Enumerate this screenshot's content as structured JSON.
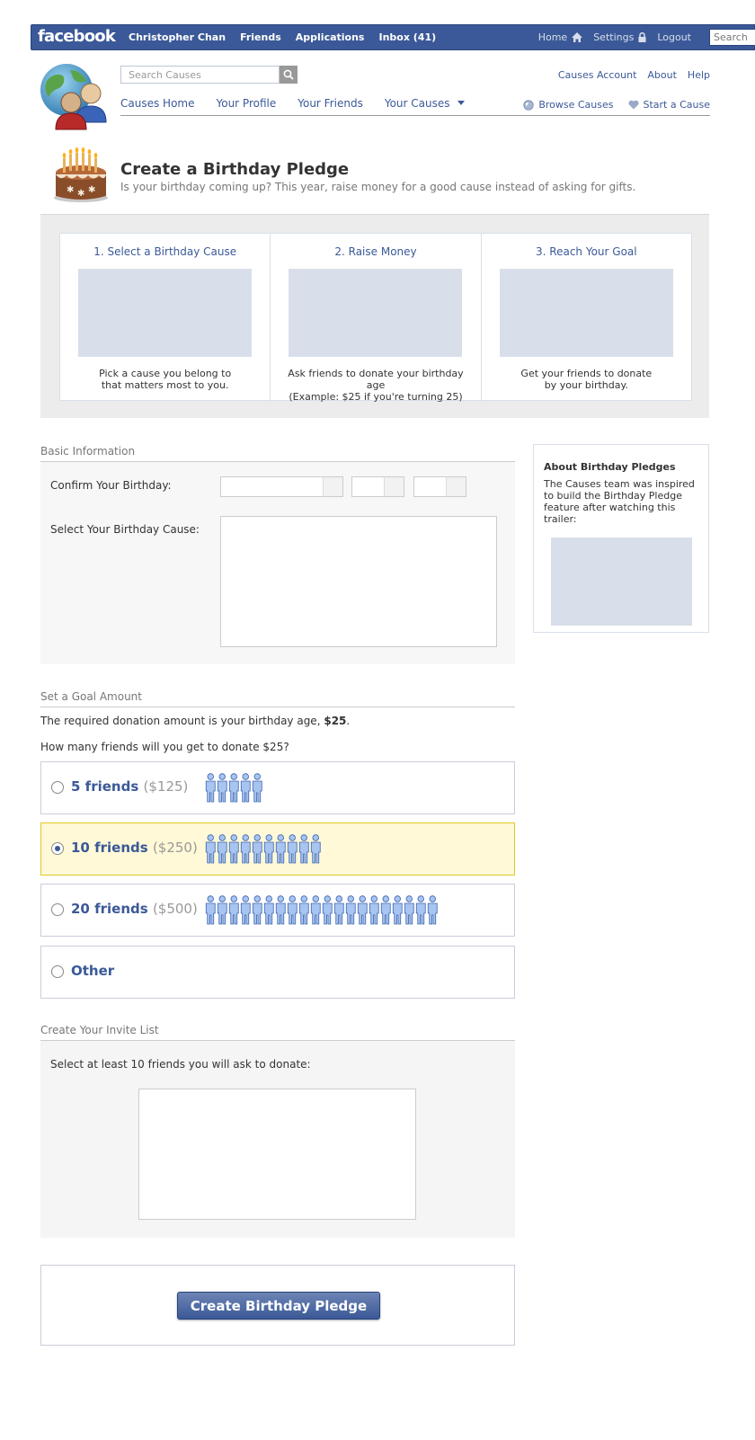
{
  "topbar": {
    "logo": "facebook",
    "nav": [
      "Christopher Chan",
      "Friends",
      "Applications",
      "Inbox (41)"
    ],
    "home": "Home",
    "settings": "Settings",
    "logout": "Logout",
    "search_placeholder": "Search"
  },
  "causes_header": {
    "search_placeholder": "Search Causes",
    "top_links": [
      "Causes Account",
      "About",
      "Help"
    ],
    "tabs": [
      "Causes Home",
      "Your Profile",
      "Your Friends",
      "Your Causes"
    ],
    "browse": "Browse Causes",
    "start": "Start a Cause"
  },
  "page": {
    "title": "Create a Birthday Pledge",
    "subtitle": "Is your birthday coming up? This year, raise money for a good cause instead of asking for gifts."
  },
  "steps": [
    {
      "title": "1. Select a Birthday Cause",
      "desc1": "Pick a cause you belong to",
      "desc2": "that matters most to you."
    },
    {
      "title": "2. Raise Money",
      "desc1": "Ask friends to donate your birthday age",
      "desc2": "(Example: $25 if you're turning 25)"
    },
    {
      "title": "3. Reach Your Goal",
      "desc1": "Get your friends to donate",
      "desc2": "by your birthday."
    }
  ],
  "basic": {
    "header": "Basic Information",
    "birthday_label": "Confirm Your Birthday:",
    "cause_label": "Select Your Birthday Cause:"
  },
  "about": {
    "title": "About Birthday Pledges",
    "desc": "The Causes team was inspired to build the Birthday Pledge feature after watching this trailer:"
  },
  "goal": {
    "header": "Set a Goal Amount",
    "required_prefix": "The required donation amount is your birthday age,",
    "required_amount": "$25",
    "required_suffix": ".",
    "question": "How many friends will you get to donate $25?",
    "options": [
      {
        "num": "5",
        "word": "friends",
        "amount": "($125)",
        "people": 5,
        "selected": false
      },
      {
        "num": "10",
        "word": "friends",
        "amount": "($250)",
        "people": 10,
        "selected": true
      },
      {
        "num": "20",
        "word": "friends",
        "amount": "($500)",
        "people": 20,
        "selected": false
      },
      {
        "num": "Other",
        "word": "",
        "amount": "",
        "people": 0,
        "selected": false
      }
    ]
  },
  "invite": {
    "header": "Create Your Invite List",
    "instruction": "Select at least 10 friends you will ask to donate:"
  },
  "submit_label": "Create Birthday Pledge",
  "colors": {
    "brand": "#3b5998",
    "selected_bg": "#fff9d7",
    "placeholder": "#d8dfea"
  }
}
